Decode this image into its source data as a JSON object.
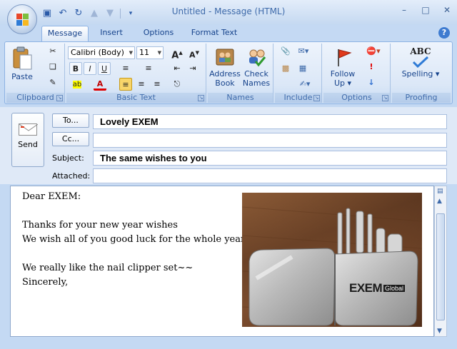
{
  "window": {
    "title": "Untitled - Message (HTML)"
  },
  "tabs": [
    "Message",
    "Insert",
    "Options",
    "Format Text"
  ],
  "ribbon": {
    "clipboard": {
      "label": "Clipboard",
      "paste": "Paste"
    },
    "basic_text": {
      "label": "Basic Text",
      "font": "Calibri (Body)",
      "size": "11"
    },
    "names": {
      "label": "Names",
      "address_book": [
        "Address",
        "Book"
      ],
      "check_names": [
        "Check",
        "Names"
      ]
    },
    "include": {
      "label": "Include"
    },
    "options": {
      "label": "Options",
      "follow_up": [
        "Follow",
        "Up ▾"
      ]
    },
    "proofing": {
      "label": "Proofing",
      "spelling": "Spelling ▾",
      "abc": "ABC"
    }
  },
  "message": {
    "send": "Send",
    "to_button": "To...",
    "cc_button": "Cc...",
    "subject_label": "Subject:",
    "attached_label": "Attached:",
    "to_value": "Lovely EXEM",
    "cc_value": "",
    "subject_value": "The same wishes to you",
    "attached_value": ""
  },
  "body": {
    "lines": [
      "Dear EXEM:",
      "",
      "Thanks for your new year wishes",
      "We wish all of you good luck for the whole year.",
      "",
      "We really like the nail clipper set~~",
      "Sincerely,"
    ],
    "photo_brand": "EXEM",
    "photo_brand_sub": "Global"
  },
  "colors": {
    "ribbon_text": "#15428b",
    "accent": "#3e6aaa",
    "window_bg": "#c4d9f3"
  }
}
